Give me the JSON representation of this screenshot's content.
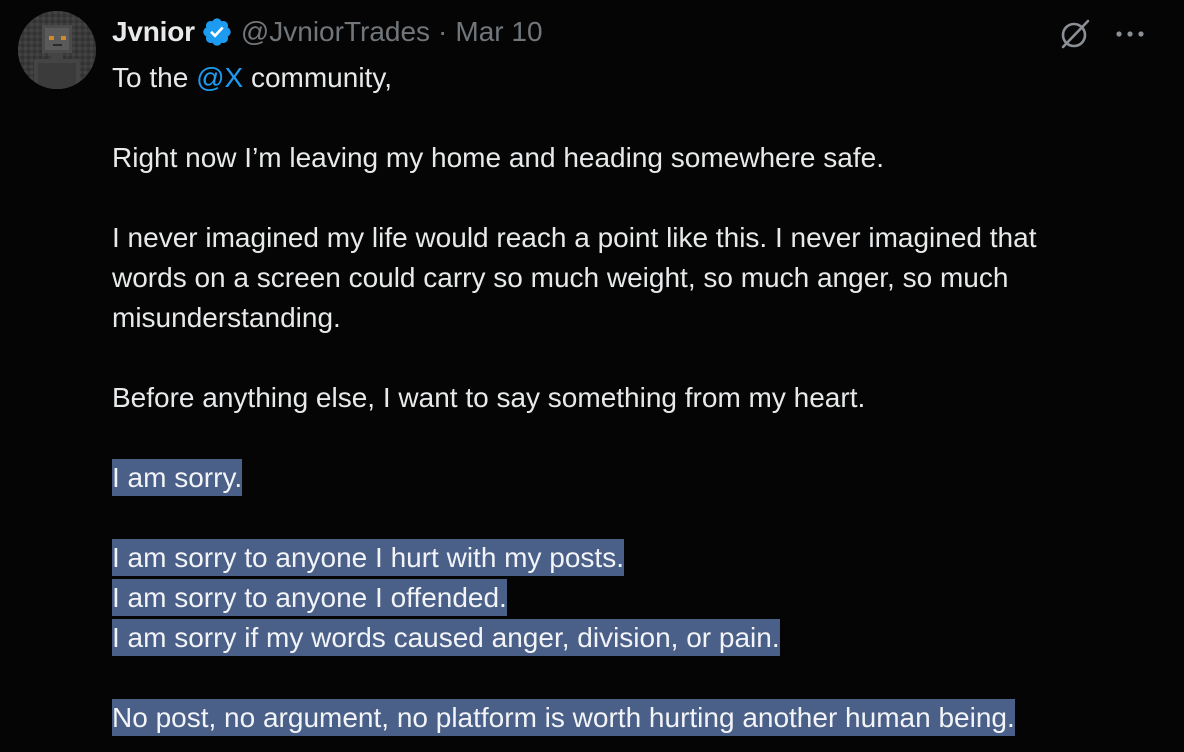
{
  "post": {
    "author": {
      "name": "Jvnior",
      "handle": "@JvniorTrades",
      "separator": "·",
      "date": "Mar 10",
      "avatar_icon": "pixel-art-avatar",
      "verified_icon": "verified-badge-icon",
      "verified_color": "#1d9bf0"
    },
    "actions": {
      "grok_icon": "grok-icon",
      "more_icon": "more-icon"
    },
    "body": {
      "greeting_prefix": "To the",
      "mention": "@X",
      "greeting_suffix": "community,",
      "p1": "Right now I’m leaving my home and heading somewhere safe.",
      "p2_line1": "I never imagined my life would reach a point like this. I never imagined that",
      "p2_line2": "words on a screen could carry so much weight, so much anger, so much",
      "p2_line3": "misunderstanding.",
      "p3": "Before anything else, I want to say something from my heart.",
      "p4": "I am sorry.",
      "p5_line1": "I am sorry to anyone I hurt with my posts.",
      "p5_line2": "I am sorry to anyone I offended.",
      "p5_line3": "I am sorry if my words caused anger, division, or pain.",
      "p6": "No post, no argument, no platform is worth hurting another human being."
    },
    "colors": {
      "background": "#050505",
      "text": "#e7e9ea",
      "muted": "#71767b",
      "link": "#1d9bf0",
      "selection": "#4a6088"
    }
  }
}
